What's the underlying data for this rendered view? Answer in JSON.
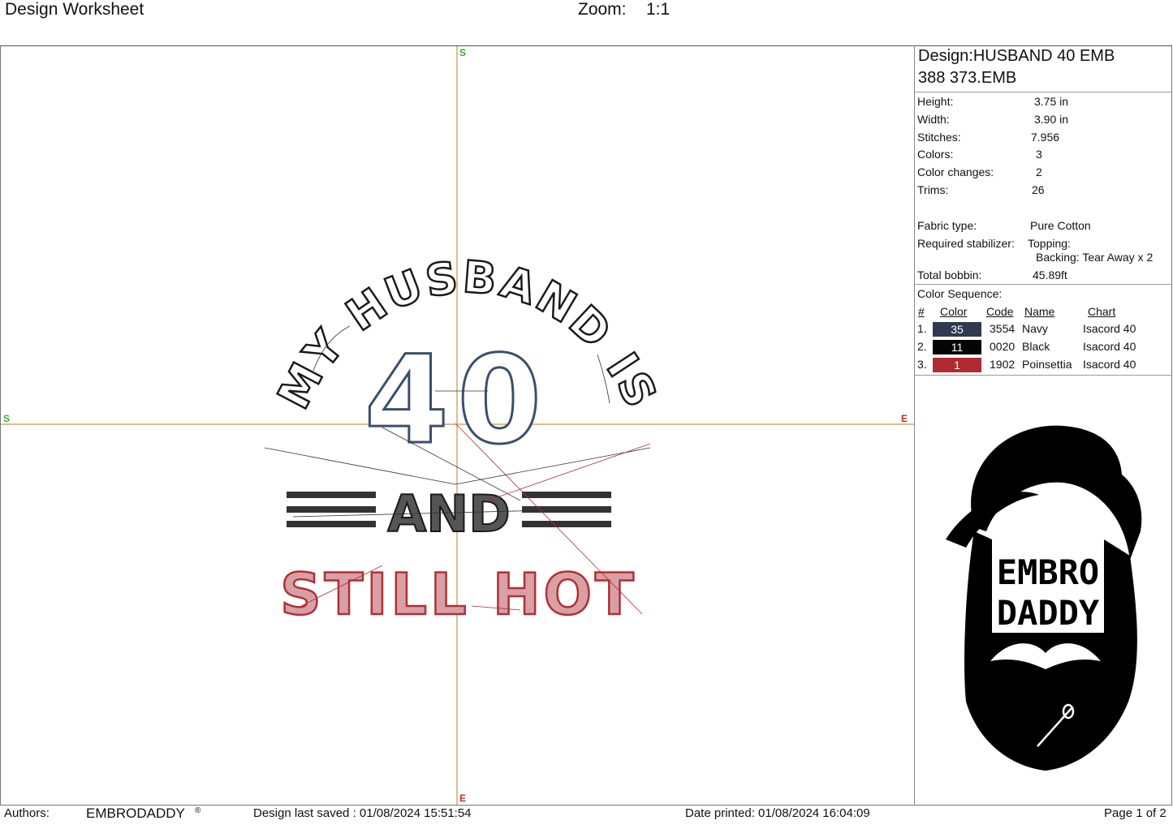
{
  "header": {
    "title": "Design Worksheet",
    "zoom_label": "Zoom:",
    "zoom_value": "1:1"
  },
  "canvas": {
    "axis_start": "S",
    "axis_end": "E",
    "axis_color": "#c8963c"
  },
  "design_art": {
    "arc_text": "MY HUSBAND IS",
    "number": "40",
    "connector": "AND",
    "bottom_text": "STILL HOT",
    "colors": {
      "navy": "#3a4f6e",
      "black": "#1a1a1a",
      "red": "#b03036"
    }
  },
  "panel": {
    "design_label": "Design:HUSBAND 40 EMB",
    "file_name": "388 373.EMB",
    "stats": [
      {
        "label": "Height:",
        "value": "3.75 in"
      },
      {
        "label": "Width:",
        "value": "3.90 in"
      },
      {
        "label": "Stitches:",
        "value": "7.956"
      },
      {
        "label": "Colors:",
        "value": "3"
      },
      {
        "label": "Color changes:",
        "value": "2"
      },
      {
        "label": "Trims:",
        "value": "26"
      }
    ],
    "fabric_label": "Fabric type:",
    "fabric_value": "Pure Cotton",
    "stabilizer_label": "Required stabilizer:",
    "topping": "Topping:",
    "backing": "Backing: Tear Away x 2",
    "bobbin_label": "Total bobbin:",
    "bobbin_value": "45.89ft",
    "color_sequence_title": "Color Sequence:",
    "columns": [
      "#",
      "Color",
      "Code",
      "Name",
      "Chart"
    ],
    "colors": [
      {
        "num": "1.",
        "swatch": "35",
        "hex": "#2e3a4f",
        "code": "3554",
        "name": "Navy",
        "chart": "Isacord 40"
      },
      {
        "num": "2.",
        "swatch": "11",
        "hex": "#050505",
        "code": "0020",
        "name": "Black",
        "chart": "Isacord 40"
      },
      {
        "num": "3.",
        "swatch": "1",
        "hex": "#b02a30",
        "code": "1902",
        "name": "Poinsettia",
        "chart": "Isacord 40"
      }
    ],
    "logo_line1": "EMBRO",
    "logo_line2": "DADDY"
  },
  "footer": {
    "authors_label": "Authors:",
    "authors_value": "EMBRODADDY",
    "registered": "®",
    "saved": "Design last saved : 01/08/2024 15:51:54",
    "printed": "Date printed: 01/08/2024 16:04:09",
    "page": "Page 1 of 2"
  }
}
